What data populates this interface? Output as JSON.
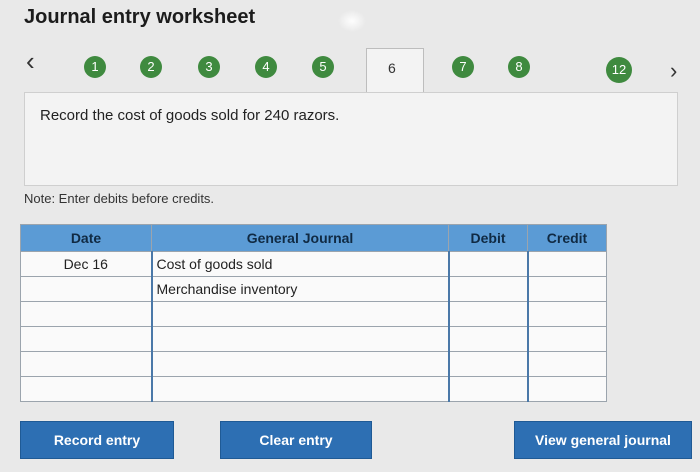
{
  "header": {
    "title": "Journal entry worksheet"
  },
  "nav": {
    "back_icon": "chevron-left-icon",
    "forward_icon": "chevron-right-icon",
    "steps": [
      "1",
      "2",
      "3",
      "4",
      "5",
      "6",
      "7",
      "8",
      "12"
    ],
    "active_step": "6"
  },
  "instruction": "Record the cost of goods sold for 240 razors.",
  "note": "Note: Enter debits before credits.",
  "journal": {
    "headers": {
      "date": "Date",
      "account": "General Journal",
      "debit": "Debit",
      "credit": "Credit"
    },
    "rows": [
      {
        "date": "Dec 16",
        "account": "Cost of goods sold",
        "debit": "",
        "credit": ""
      },
      {
        "date": "",
        "account": "Merchandise inventory",
        "debit": "",
        "credit": ""
      },
      {
        "date": "",
        "account": "",
        "debit": "",
        "credit": ""
      },
      {
        "date": "",
        "account": "",
        "debit": "",
        "credit": ""
      },
      {
        "date": "",
        "account": "",
        "debit": "",
        "credit": ""
      },
      {
        "date": "",
        "account": "",
        "debit": "",
        "credit": ""
      }
    ]
  },
  "buttons": {
    "record": "Record entry",
    "clear": "Clear entry",
    "view": "View general journal"
  },
  "colors": {
    "step_green": "#3f8a3f",
    "header_blue": "#5b9bd5",
    "button_blue": "#2d6fb3"
  }
}
